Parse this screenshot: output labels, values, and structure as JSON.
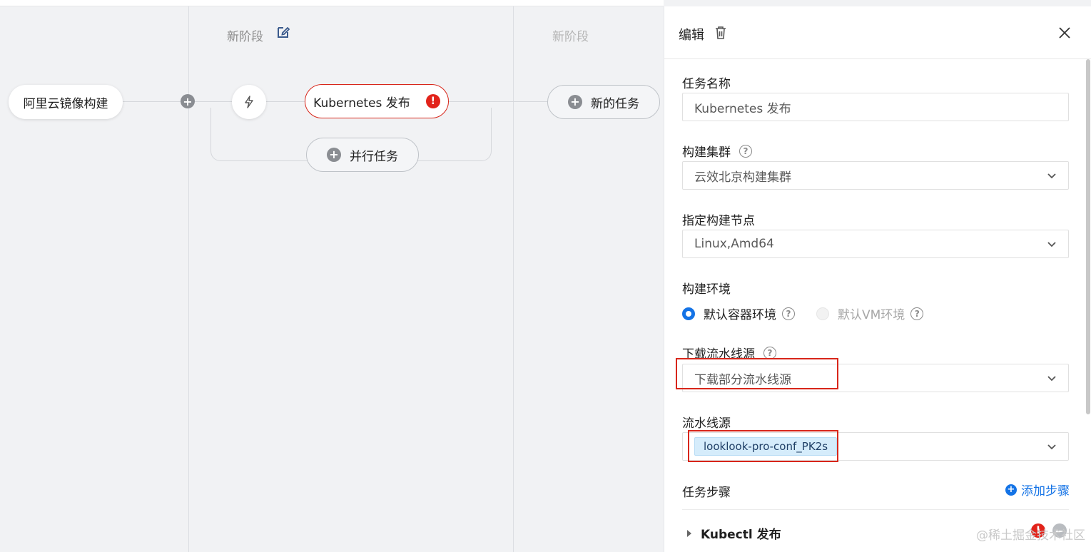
{
  "pipeline": {
    "source_node": "阿里云镜像构建",
    "stage1_title": "新阶段",
    "stage2_title": "新阶段",
    "task_node": "Kubernetes 发布",
    "parallel_task": "并行任务",
    "new_task": "新的任务"
  },
  "panel": {
    "title": "编辑",
    "task_name_label": "任务名称",
    "task_name_value": "Kubernetes 发布",
    "cluster_label": "构建集群",
    "cluster_value": "云效北京构建集群",
    "node_label": "指定构建节点",
    "node_value": "Linux,Amd64",
    "env_label": "构建环境",
    "env_option_1": "默认容器环境",
    "env_option_2": "默认VM环境",
    "download_label": "下载流水线源",
    "download_value": "下载部分流水线源",
    "source_label": "流水线源",
    "source_tag": "looklook-pro-conf_PK2s",
    "steps_label": "任务步骤",
    "add_step": "添加步骤",
    "step_1": "Kubectl 发布"
  },
  "watermark": "@稀土掘金技术社区",
  "colors": {
    "accent": "#1473e6",
    "error": "#e2231a",
    "highlight_box": "#d8261a",
    "tag_bg": "#d5ecfb"
  }
}
